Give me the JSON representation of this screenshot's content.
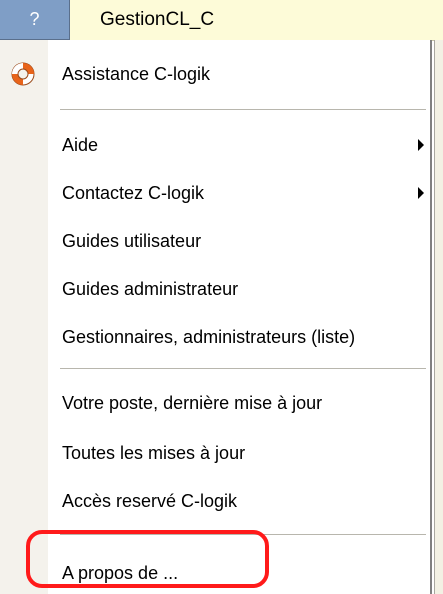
{
  "menubar": {
    "help_label": "?",
    "window_title": "GestionCL_C"
  },
  "menu": {
    "items": [
      {
        "label": "Assistance C-logik",
        "icon": "lifebuoy-icon"
      },
      {
        "label": "Aide",
        "submenu": true
      },
      {
        "label": "Contactez C-logik",
        "submenu": true
      },
      {
        "label": "Guides utilisateur"
      },
      {
        "label": "Guides administrateur"
      },
      {
        "label": "Gestionnaires, administrateurs (liste)"
      },
      {
        "label": "Votre poste, dernière mise à jour"
      },
      {
        "label": "Toutes les mises à jour"
      },
      {
        "label": "Accès reservé C-logik"
      },
      {
        "label": "A propos de ..."
      }
    ]
  },
  "colors": {
    "menubar_bg": "#fdfbd8",
    "help_menu_bg": "#7f9ec6",
    "highlight_border": "#ff1a1a",
    "lifebuoy_orange": "#e8641b"
  }
}
